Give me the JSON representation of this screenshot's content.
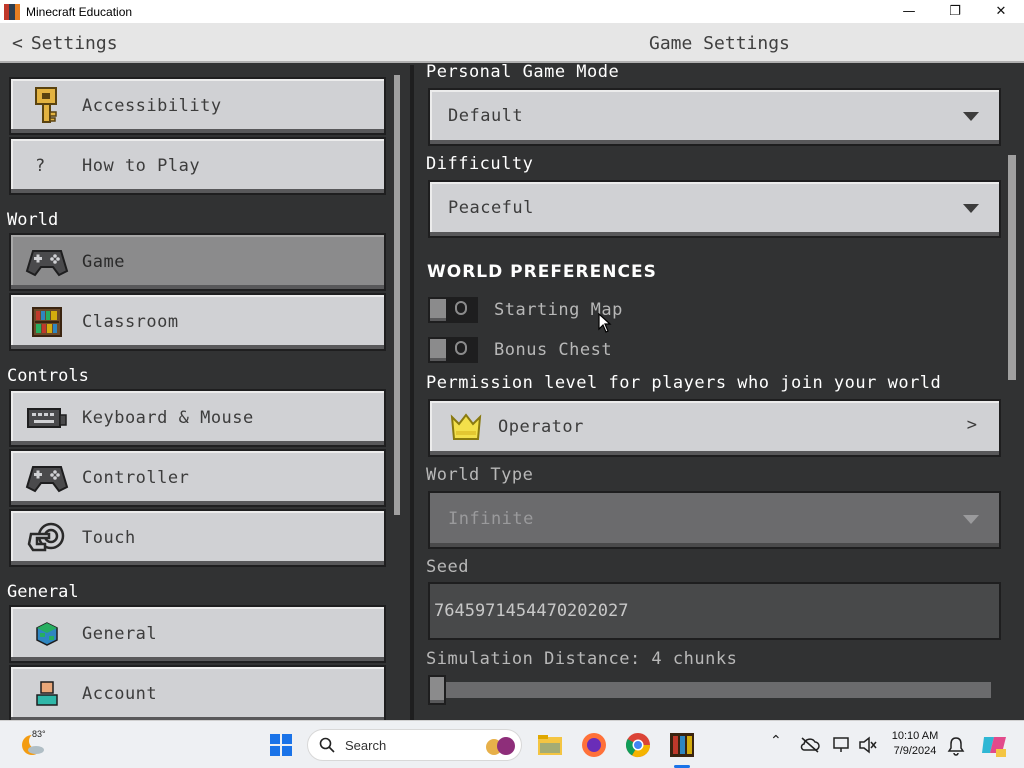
{
  "window": {
    "title": "Minecraft Education",
    "minimize": "—",
    "maximize": "❐",
    "close": "✕"
  },
  "header": {
    "back_label": "Settings",
    "title": "Game Settings"
  },
  "sidebar": {
    "items_top": [
      {
        "label": "Accessibility",
        "icon": "key-icon"
      },
      {
        "label": "How to Play",
        "icon": "question-icon"
      }
    ],
    "sections": [
      {
        "label": "World",
        "items": [
          {
            "label": "Game",
            "icon": "gamepad-icon",
            "selected": true
          },
          {
            "label": "Classroom",
            "icon": "bookshelf-icon",
            "selected": false
          }
        ]
      },
      {
        "label": "Controls",
        "items": [
          {
            "label": "Keyboard & Mouse",
            "icon": "keyboard-icon"
          },
          {
            "label": "Controller",
            "icon": "controller-icon"
          },
          {
            "label": "Touch",
            "icon": "touch-icon"
          }
        ]
      },
      {
        "label": "General",
        "items": [
          {
            "label": "General",
            "icon": "globe-icon"
          },
          {
            "label": "Account",
            "icon": "account-icon"
          }
        ]
      }
    ]
  },
  "game_settings": {
    "personal_game_mode": {
      "label": "Personal Game Mode",
      "value": "Default"
    },
    "difficulty": {
      "label": "Difficulty",
      "value": "Peaceful"
    },
    "world_preferences": {
      "heading": "WORLD PREFERENCES",
      "toggles": [
        {
          "label": "Starting Map",
          "on": false
        },
        {
          "label": "Bonus Chest",
          "on": false
        }
      ]
    },
    "permission": {
      "label": "Permission level for players who join your world",
      "value": "Operator",
      "icon": "crown-icon"
    },
    "world_type": {
      "label": "World Type",
      "value": "Infinite",
      "disabled": true
    },
    "seed": {
      "label": "Seed",
      "value": "7645971454470202027"
    },
    "simulation_distance": {
      "label": "Simulation Distance: 4 chunks",
      "fraction": 0
    }
  },
  "taskbar": {
    "weather_temp": "83°",
    "search_placeholder": "Search",
    "time": "10:10 AM",
    "date": "7/9/2024",
    "accent": "#1a73e8"
  }
}
